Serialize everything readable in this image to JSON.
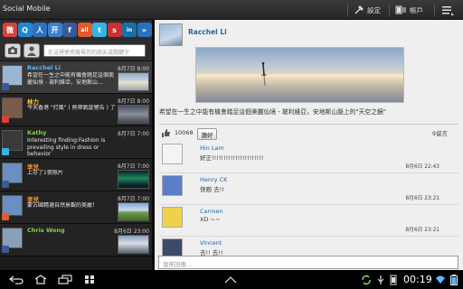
{
  "app": {
    "title": "Social Mobile"
  },
  "actionbar": {
    "settings_label": "設定",
    "account_label": "帳戶"
  },
  "sns_services": [
    {
      "icon": "weibo-icon",
      "glyph": "微",
      "color": "#d8403a"
    },
    {
      "icon": "tencent-icon",
      "glyph": "Q",
      "color": "#1e88d6"
    },
    {
      "icon": "renren-icon",
      "glyph": "人",
      "color": "#2f6fbf"
    },
    {
      "icon": "kaixin-icon",
      "glyph": "开",
      "color": "#3c7fd0"
    },
    {
      "icon": "facebook-icon",
      "glyph": "f",
      "color": "#3b5998"
    },
    {
      "icon": "all-icon",
      "glyph": "all",
      "color": "#e55a2b"
    },
    {
      "icon": "twitter-icon",
      "glyph": "t",
      "color": "#34b4e6"
    },
    {
      "icon": "sina-icon",
      "glyph": "s",
      "color": "#cc3030"
    },
    {
      "icon": "linkedin-icon",
      "glyph": "in",
      "color": "#1a6fa8"
    },
    {
      "icon": "more-icon",
      "glyph": "»",
      "color": "#2a70c0"
    }
  ],
  "search": {
    "placeholder": "在這裡使用搜尋您的朋友或關鍵字"
  },
  "feed": [
    {
      "name": "Racchel Li",
      "date": "8月7日",
      "time": "8:00",
      "text": "希望在一生之中能有機會踏足這個美麗仙境 - 玻利維亞，安地斯山…",
      "name_color": "#59b8ff",
      "selected": true,
      "has_thumb": true,
      "thumb": "salt-flat-photo",
      "avatar_color": "#9bb5d3",
      "badge_color": "#3b5998"
    },
    {
      "name": "林力",
      "date": "8月7日",
      "time": "8:00",
      "text": "今天香港 \"打風\" ( 熱帶氣旋警告 ) 了",
      "name_color": "#ffcc33",
      "selected": false,
      "has_thumb": true,
      "thumb": "storm-photo",
      "avatar_color": "#7c5a4a",
      "badge_color": "#d8403a"
    },
    {
      "name": "Kathy",
      "date": "8月7日",
      "time": "7:00",
      "text": "Interesting finding:Fashion is prevailing style in dress or behavior",
      "name_color": "#7fd24a",
      "selected": false,
      "has_thumb": false,
      "thumb": "",
      "avatar_color": "#3a3a3a",
      "badge_color": "#34b4e6"
    },
    {
      "name": "李兒",
      "date": "8月7日",
      "time": "7:00",
      "text": "上存了1張照片",
      "name_color": "#ff9a33",
      "selected": false,
      "has_thumb": true,
      "thumb": "aurora-photo",
      "avatar_color": "#6a8fc0",
      "badge_color": "#3b5998"
    },
    {
      "name": "李兒",
      "date": "8月7日",
      "time": "7:00",
      "text": "蒙古國精選自然景觀的美麗！",
      "name_color": "#ff9a33",
      "selected": false,
      "has_thumb": true,
      "thumb": "landscape-photo",
      "avatar_color": "#6a8fc0",
      "badge_color": "#e55a2b"
    },
    {
      "name": "Chris Wong",
      "date": "8月6日",
      "time": "23:00",
      "text": "",
      "name_color": "#7fd24a",
      "selected": false,
      "has_thumb": true,
      "thumb": "city-photo",
      "avatar_color": "#88a0b8",
      "badge_color": "#3b5998"
    }
  ],
  "post": {
    "author": "Racchel Li",
    "text": "希望在一生之中能有機會踏足這個美麗仙境 - 玻利維亞，安地斯山脈上的\"天空之鏡\"",
    "likes": "10068",
    "like_button": "讚好",
    "comment_count": "9留言"
  },
  "comments": [
    {
      "name": "Hin Lam",
      "text": "好正!!!!!!!!!!!!!!!!!!!!!!",
      "time": "8月6日 22:43",
      "avatar_color": "#f4f4f4"
    },
    {
      "name": "Henry CK",
      "text": "快啲 去!!",
      "time": "8月6日 23:21",
      "avatar_color": "#5a7fc8"
    },
    {
      "name": "Carmen",
      "text": "XD ~~",
      "time": "8月6日 23:21",
      "avatar_color": "#f0d24a"
    },
    {
      "name": "Vincent",
      "text": "去!! 去!!",
      "time": "8月6日 23:21",
      "avatar_color": "#3d4a6a"
    }
  ],
  "reply": {
    "placeholder": "發佈回應..."
  },
  "system": {
    "clock": "00:19"
  }
}
